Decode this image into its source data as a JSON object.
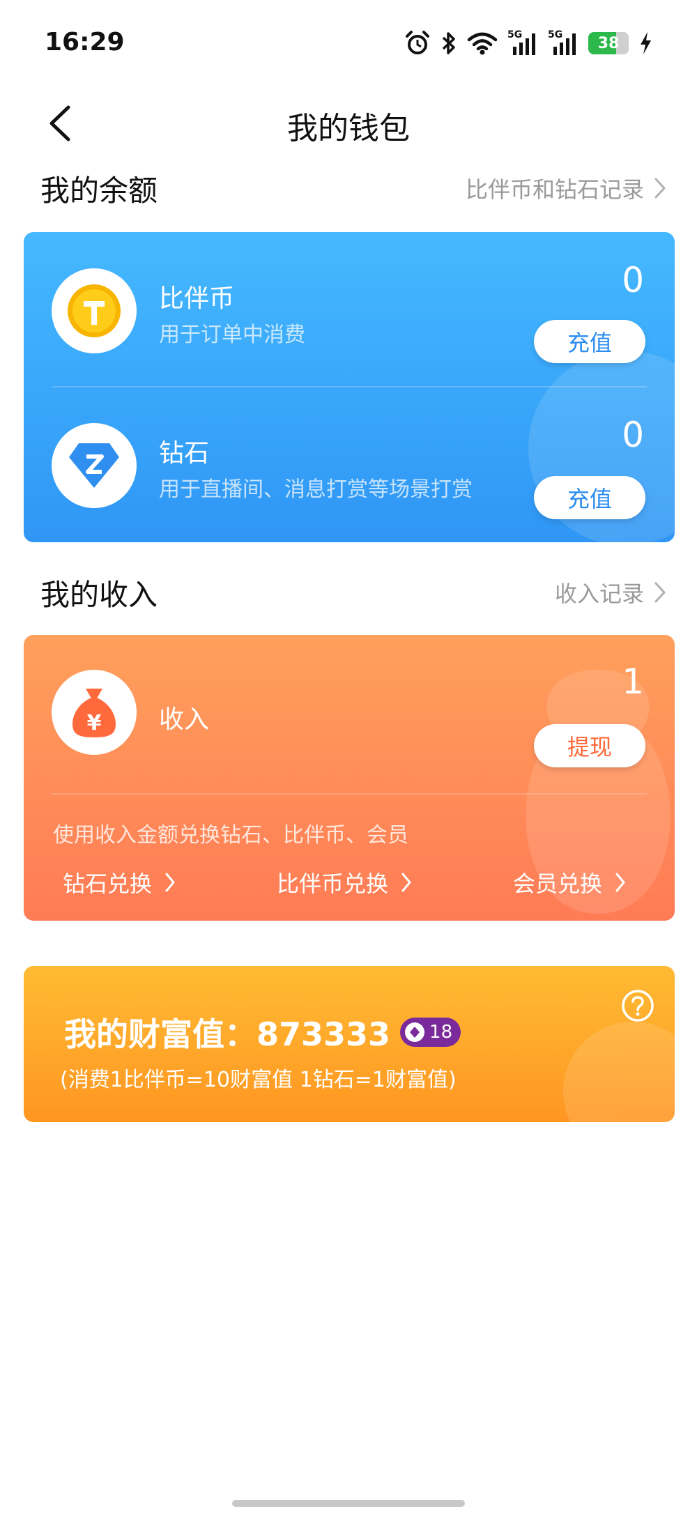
{
  "status_bar": {
    "time": "16:29",
    "battery_level": "38",
    "network_1": "5G",
    "network_2": "5G"
  },
  "nav": {
    "title": "我的钱包"
  },
  "balance_section": {
    "title": "我的余额",
    "link_label": "比伴币和钻石记录"
  },
  "balance": {
    "coin": {
      "name": "比伴币",
      "desc": "用于订单中消费",
      "value": "0",
      "button_label": "充值",
      "icon_letter": "T"
    },
    "diamond": {
      "name": "钻石",
      "desc": "用于直播间、消息打赏等场景打赏",
      "value": "0",
      "button_label": "充值",
      "icon_letter": "Z"
    }
  },
  "income_section": {
    "title": "我的收入",
    "link_label": "收入记录"
  },
  "income": {
    "name": "收入",
    "value": "1",
    "button_label": "提现",
    "icon_symbol": "¥",
    "exchange_hint": "使用收入金额兑换钻石、比伴币、会员",
    "exchange_links": [
      "钻石兑换",
      "比伴币兑换",
      "会员兑换"
    ]
  },
  "wealth": {
    "title": "我的财富值：873333",
    "badge_level": "18",
    "rule": "(消费1比伴币=10财富值 1钻石=1财富值)"
  },
  "colors": {
    "blue_accent": "#2a8cf0",
    "orange_accent": "#ff6838",
    "gold_card": "#ffa726",
    "badge_purple": "#7b2a9b"
  },
  "icons": [
    "alarm-icon",
    "bluetooth-icon",
    "wifi-icon",
    "signal-icon",
    "battery-icon",
    "charging-icon",
    "back-arrow-icon",
    "chevron-right-icon",
    "coin-icon",
    "diamond-icon",
    "money-bag-icon",
    "help-icon"
  ]
}
